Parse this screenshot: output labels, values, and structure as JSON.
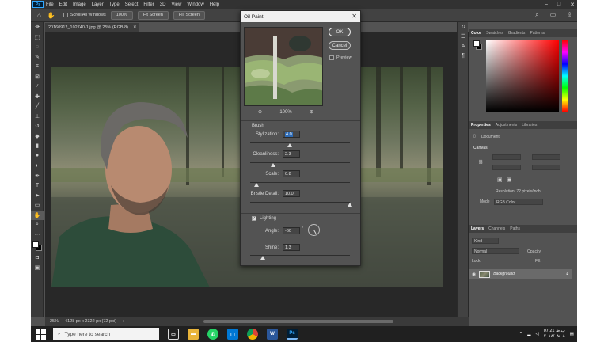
{
  "app": {
    "logo_text": "Ps",
    "menu": [
      "File",
      "Edit",
      "Image",
      "Layer",
      "Type",
      "Select",
      "Filter",
      "3D",
      "View",
      "Window",
      "Help"
    ]
  },
  "options_bar": {
    "scroll_all_label": "Scroll All Windows",
    "btn_100": "100%",
    "btn_fit": "Fit Screen",
    "btn_fill": "Fill Screen"
  },
  "document": {
    "tab_title": "20160912_102740-1.jpg @ 25% (RGB/8)",
    "status_zoom": "25%",
    "status_info": "4128 px x 2322 px (72 ppi)"
  },
  "dialog": {
    "title": "Oil Paint",
    "ok_label": "OK",
    "cancel_label": "Cancel",
    "preview_label": "Preview",
    "preview_checked": false,
    "zoom_level": "100%",
    "brush_header": "Brush",
    "stylization_label": "Stylization:",
    "stylization_value": "4.0",
    "stylization_fraction": 0.4,
    "cleanliness_label": "Cleanliness:",
    "cleanliness_value": "2.3",
    "cleanliness_fraction": 0.23,
    "scale_label": "Scale:",
    "scale_value": "0.8",
    "scale_fraction": 0.06,
    "bristle_label": "Bristle Detail:",
    "bristle_value": "10.0",
    "bristle_fraction": 1.0,
    "lighting_label": "Lighting",
    "lighting_checked": true,
    "angle_label": "Angle:",
    "angle_value": "-60",
    "angle_unit": "°",
    "shine_label": "Shine:",
    "shine_value": "1.3",
    "shine_fraction": 0.13
  },
  "panels": {
    "color_tabs": [
      "Color",
      "Swatches",
      "Gradients",
      "Patterns"
    ],
    "props_tabs": [
      "Properties",
      "Adjustments",
      "Libraries"
    ],
    "document_label": "Document",
    "canvas_header": "Canvas",
    "resolution_text": "Resolution: 72 pixels/inch",
    "mode_label": "Mode",
    "mode_value": "RGB Color",
    "layers_tabs": [
      "Layers",
      "Channels",
      "Paths"
    ],
    "kind_label": "Kind",
    "blend_mode": "Normal",
    "opacity_label": "Opacity:",
    "lock_label": "Lock:",
    "fill_label": "Fill:",
    "layer_name": "Background"
  },
  "taskbar": {
    "search_placeholder": "Type here to search",
    "time": "07:21 ب.ظ",
    "date": "۲۰۱۸/۰۸/۰۸"
  },
  "colors": {
    "accent": "#31a8ff",
    "selection": "#2d6ab4"
  }
}
